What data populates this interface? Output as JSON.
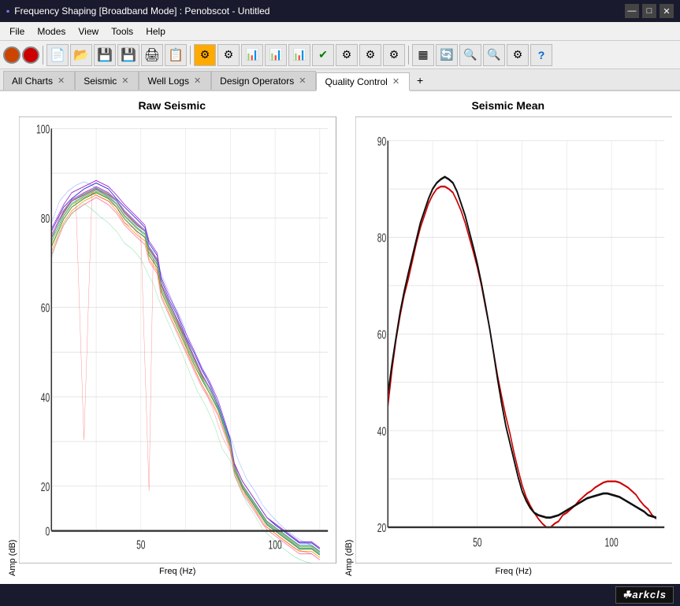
{
  "titlebar": {
    "title": "Frequency Shaping [Broadband Mode] : Penobscot - Untitled",
    "icon": "▪",
    "controls": {
      "minimize": "—",
      "maximize": "□",
      "close": "✕"
    }
  },
  "menubar": {
    "items": [
      "File",
      "Modes",
      "View",
      "Tools",
      "Help"
    ]
  },
  "toolbar": {
    "buttons": [
      "⬤",
      "⬤",
      "📄",
      "📂",
      "💾",
      "💾",
      "🖨",
      "📋",
      "⚙",
      "⚙",
      "📊",
      "📊",
      "📊",
      "✔",
      "⚙",
      "⚙",
      "⚙",
      "▦",
      "🔄",
      "🔍",
      "🔍",
      "⚙",
      "?"
    ]
  },
  "tabs": {
    "items": [
      {
        "label": "All Charts",
        "closable": true,
        "active": false
      },
      {
        "label": "Seismic",
        "closable": true,
        "active": false
      },
      {
        "label": "Well Logs",
        "closable": true,
        "active": false
      },
      {
        "label": "Design Operators",
        "closable": true,
        "active": false
      },
      {
        "label": "Quality Control",
        "closable": true,
        "active": true
      }
    ],
    "add_label": "+"
  },
  "charts": {
    "left": {
      "title": "Raw Seismic",
      "x_label": "Freq (Hz)",
      "y_label": "Amp (dB)",
      "y_ticks": [
        "100",
        "80",
        "60",
        "40",
        "20",
        "0"
      ],
      "x_ticks": [
        "50",
        "100"
      ]
    },
    "right": {
      "title": "Seismic Mean",
      "x_label": "Freq (Hz)",
      "y_label": "Amp (dB)",
      "y_ticks": [
        "80",
        "60",
        "40",
        "20"
      ],
      "x_ticks": [
        "50",
        "100"
      ]
    }
  },
  "bottombar": {
    "logo": "arkcls"
  }
}
